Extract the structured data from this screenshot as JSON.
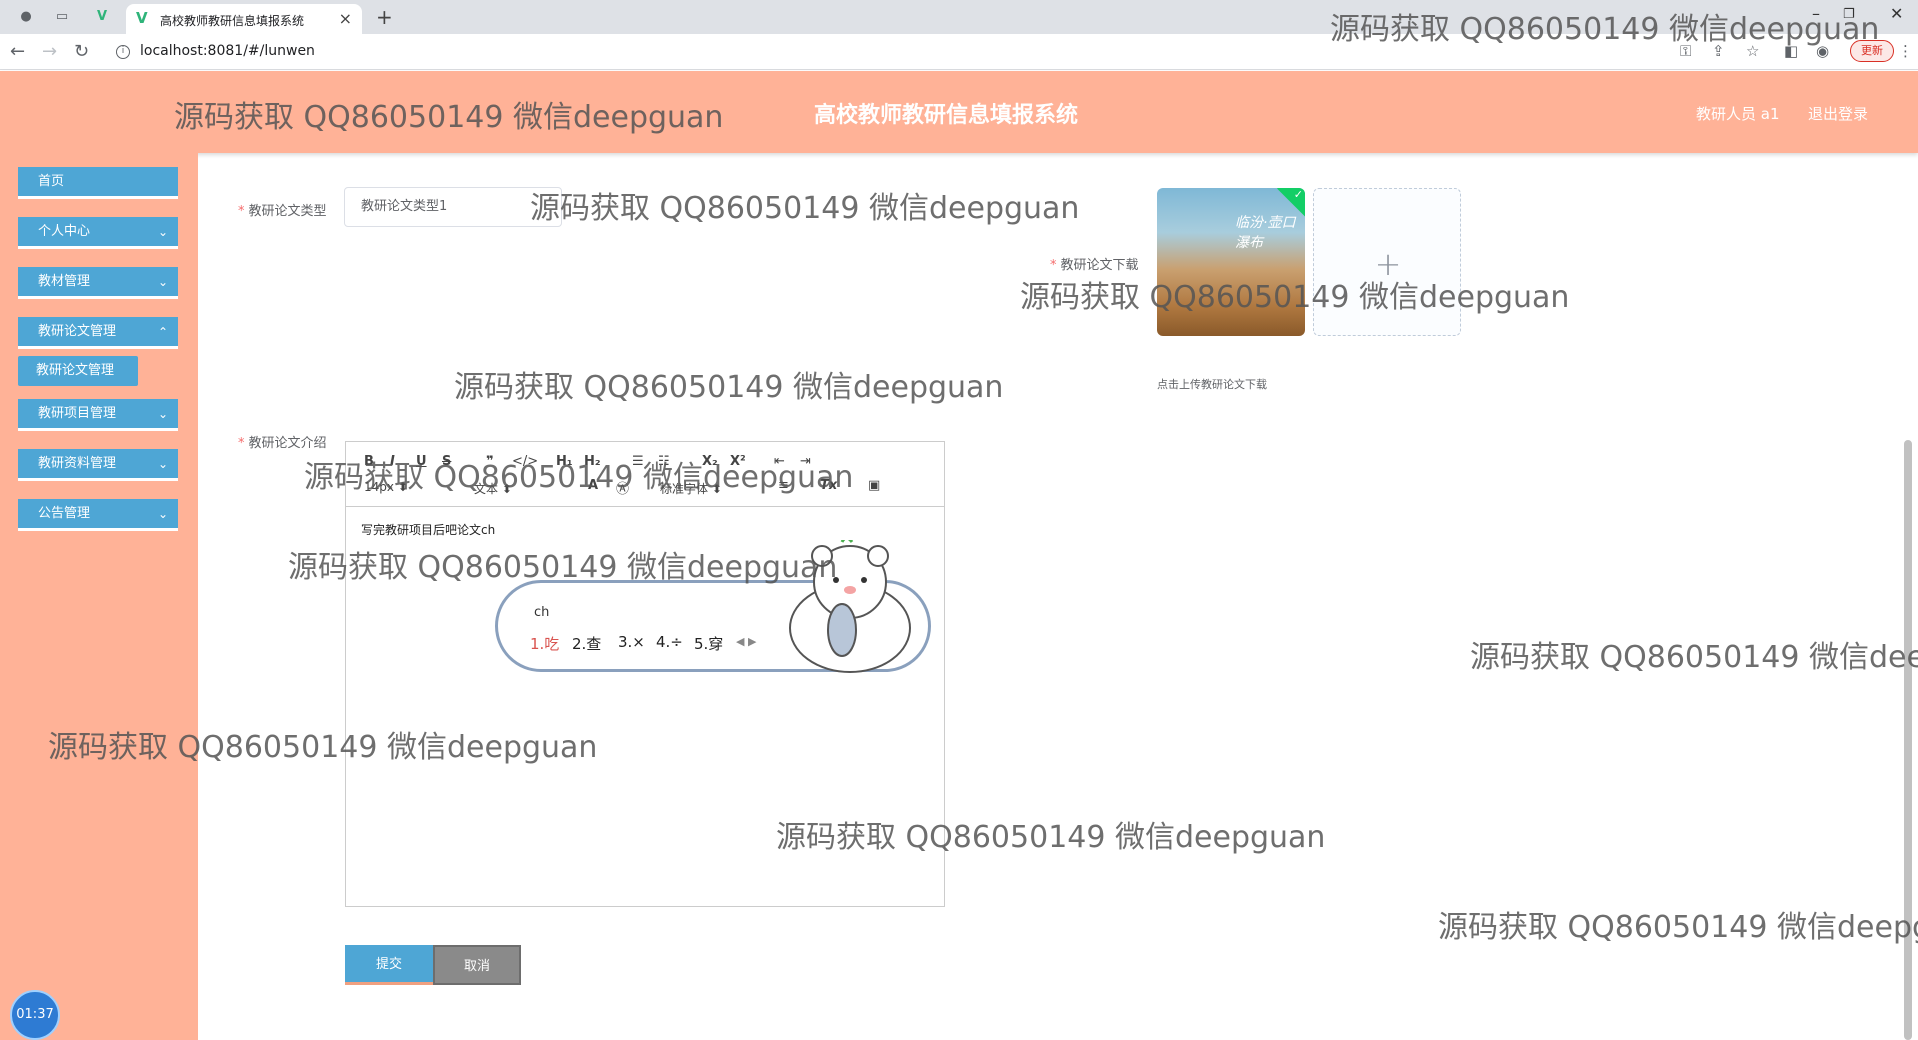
{
  "browser": {
    "tab_title": "高校教师教研信息填报系统",
    "url": "localhost:8081/#/lunwen",
    "update_label": "更新"
  },
  "header": {
    "title": "高校教师教研信息填报系统",
    "user": "教研人员 a1",
    "logout": "退出登录"
  },
  "sidebar": {
    "items": [
      {
        "label": "首页"
      },
      {
        "label": "个人中心"
      },
      {
        "label": "教材管理"
      },
      {
        "label": "教研论文管理"
      },
      {
        "label": "教研项目管理"
      },
      {
        "label": "教研资料管理"
      },
      {
        "label": "公告管理"
      }
    ],
    "submenu_label": "教研论文管理"
  },
  "form": {
    "type_label": "教研论文类型",
    "type_value": "教研论文类型1",
    "download_label": "教研论文下载",
    "upload_tip": "点击上传教研论文下载",
    "intro_label": "教研论文介绍",
    "editor": {
      "font_size": "14px",
      "paragraph": "文本",
      "font_family": "标准字体",
      "content": "写完教研项目后吧论文ch"
    },
    "submit": "提交",
    "cancel": "取消"
  },
  "ime": {
    "typed": "ch",
    "candidates": [
      "1.吃",
      "2.查",
      "3.×",
      "4.÷",
      "5.穿"
    ]
  },
  "timer": "01:37",
  "watermark": "源码获取 QQ86050149 微信deepguan",
  "colors": {
    "header_bg": "#ffb297",
    "menu_bg": "#4ea6d5",
    "required": "#f56c6c"
  }
}
